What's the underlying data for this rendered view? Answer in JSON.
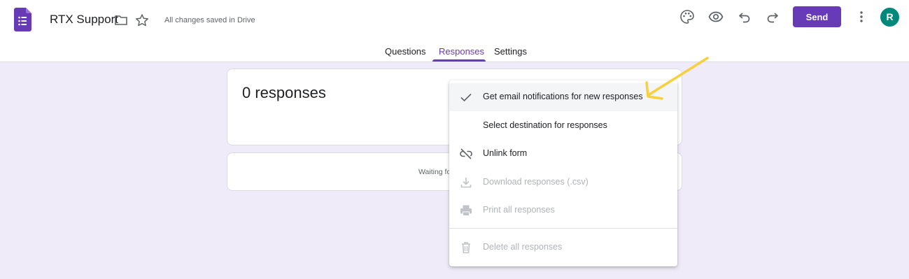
{
  "header": {
    "title": "RTX Support",
    "save_status": "All changes saved in Drive",
    "send_label": "Send",
    "avatar_initial": "R",
    "icons": [
      "forms-logo-icon",
      "folder-icon",
      "star-icon",
      "palette-icon",
      "eye-icon",
      "undo-icon",
      "redo-icon",
      "more-vert-icon"
    ]
  },
  "tabs": [
    {
      "label": "Questions",
      "active": false
    },
    {
      "label": "Responses",
      "active": true
    },
    {
      "label": "Settings",
      "active": false
    }
  ],
  "responses_card": {
    "count_text": "0 responses"
  },
  "waiting_card": {
    "text": "Waiting fo"
  },
  "menu": {
    "items": [
      {
        "label": "Get email notifications for new responses",
        "icon": "check-icon",
        "disabled": false,
        "checked": true
      },
      {
        "label": "Select destination for responses",
        "icon": "",
        "disabled": false
      },
      {
        "label": "Unlink form",
        "icon": "link-off-icon",
        "disabled": false
      },
      {
        "label": "Download responses (.csv)",
        "icon": "download-icon",
        "disabled": true
      },
      {
        "label": "Print all responses",
        "icon": "print-icon",
        "disabled": true
      },
      {
        "label": "Delete all responses",
        "icon": "trash-icon",
        "disabled": true
      }
    ]
  },
  "colors": {
    "brand": "#673ab7",
    "page_background": "#f0ebf8",
    "avatar": "#00897b",
    "annotation_arrow": "#f9cf3c"
  }
}
